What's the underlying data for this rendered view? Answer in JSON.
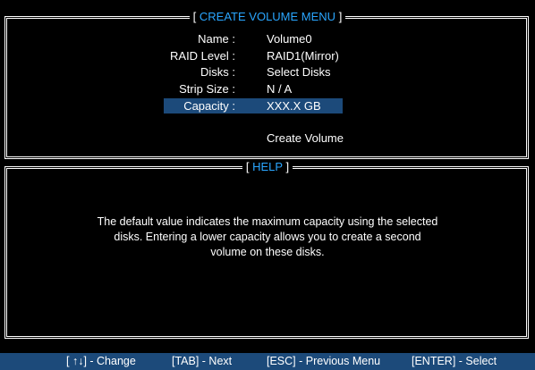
{
  "menu": {
    "title": "CREATE VOLUME MENU",
    "bracket_open": "[",
    "bracket_close": "]",
    "fields": [
      {
        "label": "Name :",
        "value": "Volume0"
      },
      {
        "label": "RAID Level :",
        "value": "RAID1(Mirror)"
      },
      {
        "label": "Disks :",
        "value": "Select  Disks"
      },
      {
        "label": "Strip Size :",
        "value": "N / A"
      },
      {
        "label": "Capacity :",
        "value": "XXX.X  GB"
      }
    ],
    "create_volume": "Create Volume"
  },
  "help": {
    "title": "HELP",
    "lines": [
      "The default value indicates the maximum capacity using the selected",
      "disks. Entering a lower capacity allows you to create a second",
      "volume on these disks."
    ]
  },
  "footer": {
    "change": "[ ↑↓] - Change",
    "next": "[TAB] - Next",
    "previous": "[ESC] - Previous Menu",
    "select": "[ENTER] - Select"
  },
  "colors": {
    "accent": "#2aa6ff",
    "highlight": "#1c4a7a",
    "background": "#000000"
  }
}
